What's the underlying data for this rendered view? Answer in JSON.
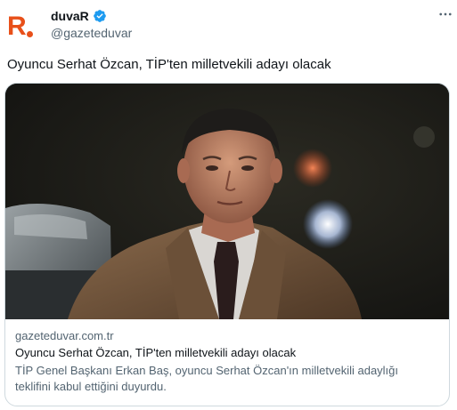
{
  "account": {
    "display_name": "duvaR",
    "handle": "@gazeteduvar",
    "avatar_letter": "R",
    "brand_color": "#e8501a",
    "verified_color": "#1d9bf0"
  },
  "tweet": {
    "text": "Oyuncu Serhat Özcan, TİP'ten milletvekili adayı olacak",
    "more_icon": "more-horizontal-icon"
  },
  "card": {
    "domain": "gazeteduvar.com.tr",
    "title": "Oyuncu Serhat Özcan, TİP'ten milletvekili adayı olacak",
    "description": "TİP Genel Başkanı Erkan Baş, oyuncu Serhat Özcan'ın milletvekili adaylığı teklifini kabul ettiğini duyurdu."
  }
}
